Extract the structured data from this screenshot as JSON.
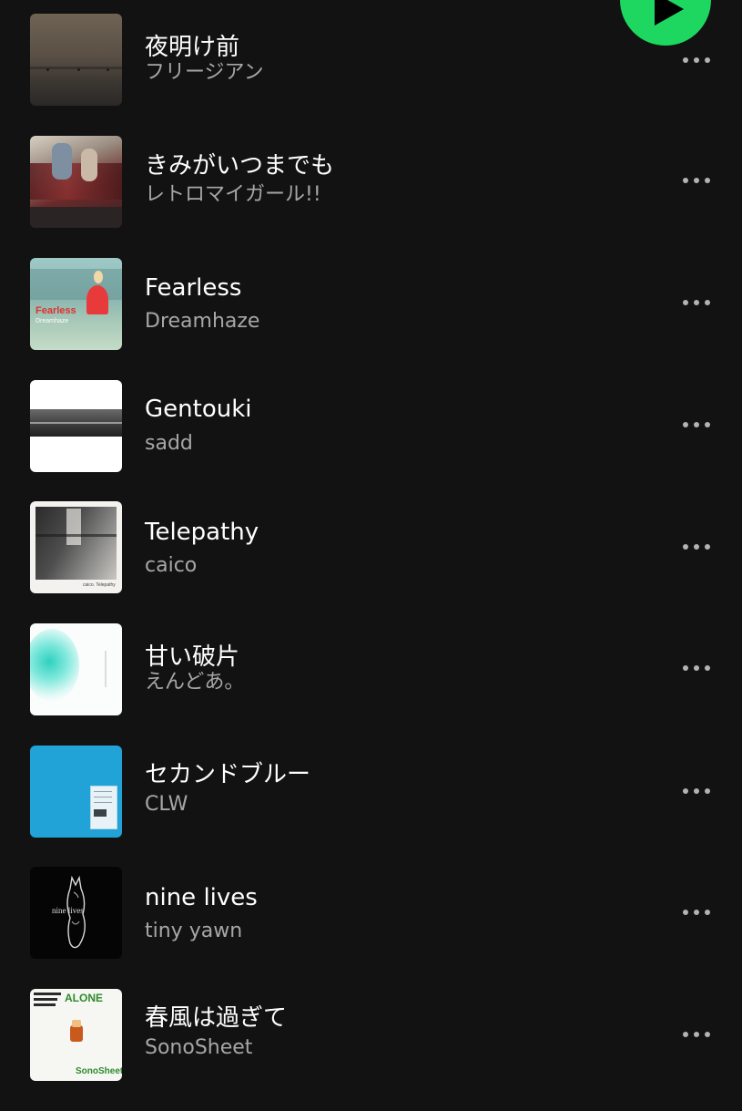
{
  "accent_color": "#1ed760",
  "play_button": {
    "icon": "play-icon"
  },
  "more_icon": "more-options-icon",
  "tracks": [
    {
      "title": "夜明け前",
      "artist": "フリージアン"
    },
    {
      "title": "きみがいつまでも",
      "artist": "レトロマイガール!!"
    },
    {
      "title": "Fearless",
      "artist": "Dreamhaze",
      "art_caption": "Fearless",
      "art_subcaption": "Dreamhaze"
    },
    {
      "title": "Gentouki",
      "artist": "sadd"
    },
    {
      "title": "Telepathy",
      "artist": "caico",
      "art_caption": "caico. Telepathy"
    },
    {
      "title": "甘い破片",
      "artist": "えんどあ。"
    },
    {
      "title": "セカンドブルー",
      "artist": "CLW"
    },
    {
      "title": "nine lives",
      "artist": "tiny yawn",
      "art_caption": "nine lives"
    },
    {
      "title": "春風は過ぎて",
      "artist": "SonoSheet",
      "art_caption": "ALONE",
      "art_subcaption": "SonoSheet"
    }
  ]
}
